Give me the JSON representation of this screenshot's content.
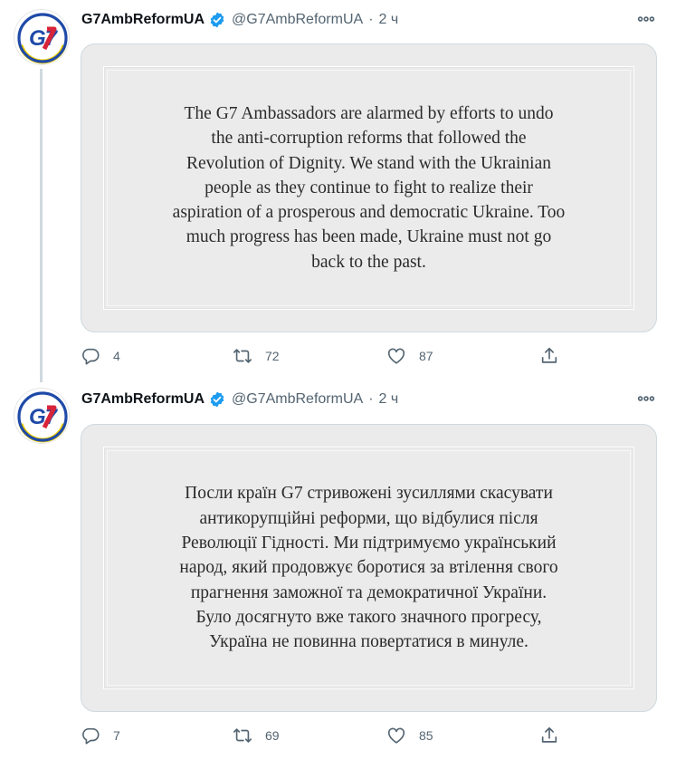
{
  "tweets": [
    {
      "author": {
        "display_name": "G7AmbReformUA",
        "handle": "@G7AmbReformUA",
        "verified": true,
        "avatar_text": "G7"
      },
      "separator": "·",
      "time": "2 ч",
      "image_text": "The G7 Ambassadors are alarmed by efforts to undo the anti-corruption reforms that followed the Revolution of Dignity. We stand with the Ukrainian people as they continue to fight to realize their aspiration of a prosperous and democratic Ukraine. Too much progress has been made, Ukraine must not go back to the past.",
      "stats": {
        "replies": "4",
        "retweets": "72",
        "likes": "87"
      }
    },
    {
      "author": {
        "display_name": "G7AmbReformUA",
        "handle": "@G7AmbReformUA",
        "verified": true,
        "avatar_text": "G7"
      },
      "separator": "·",
      "time": "2 ч",
      "image_text": "Посли країн G7 стривожені зусиллями скасувати антикорупційні реформи, що відбулися після Революції Гідності. Ми підтримуємо український народ, який продовжує боротися за втілення свого прагнення заможної та демократичної України. Було досягнуто вже такого значного прогресу, Україна не повинна повертатися в минуле.",
      "stats": {
        "replies": "7",
        "retweets": "69",
        "likes": "85"
      }
    }
  ],
  "icons": {
    "more": "more-horizontal-icon",
    "reply": "reply-icon",
    "retweet": "retweet-icon",
    "like": "heart-icon",
    "share": "share-icon",
    "verified": "verified-badge-icon"
  },
  "colors": {
    "text": "#0f1419",
    "secondary": "#536471",
    "verified": "#1d9bf0",
    "avatar_ring_blue": "#1f4aa8",
    "avatar_ring_yellow": "#f5d000",
    "avatar_red": "#d8243a",
    "image_bg": "#ebebeb",
    "thread_line": "#cfd9de"
  }
}
